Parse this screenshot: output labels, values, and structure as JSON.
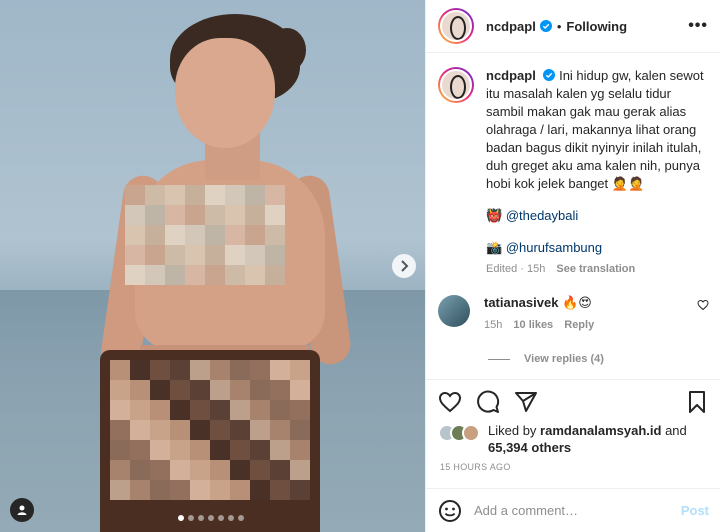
{
  "header": {
    "username": "ncdpapl",
    "separator": "•",
    "follow_status": "Following",
    "more_label": "•••"
  },
  "caption": {
    "username": "ncdpapl",
    "text": "Ini hidup gw, kalen sewot itu masalah kalen yg selalu tidur sambil makan gak mau gerak alias olahraga / lari, makannya lihat orang badan bagus dikit nyinyir inilah itulah, duh greget aku ama kalen nih, punya hobi kok jelek banget 🤦🤦",
    "mention1_emoji": "👹",
    "mention1": "@thedaybali",
    "mention2_emoji": "📸",
    "mention2": "@hurufsambung",
    "edited": "Edited · 15h",
    "see_translation": "See translation"
  },
  "comment": {
    "username": "tatianasivek",
    "text": "🔥😍",
    "time": "15h",
    "likes": "10 likes",
    "reply": "Reply",
    "view_replies": "View replies (4)"
  },
  "likes": {
    "prefix": "Liked by",
    "liker": "ramdanalamsyah.id",
    "and": "and",
    "others": "65,394 others"
  },
  "timestamp": "15 HOURS AGO",
  "comment_box": {
    "placeholder": "Add a comment…",
    "post_label": "Post"
  },
  "carousel": {
    "slide_count": 7,
    "active_index": 0
  },
  "colors": {
    "verified": "#0095f6",
    "link": "#00376b",
    "muted": "#8e8e8e",
    "post_disabled": "#b2dffc"
  },
  "icons": [
    "verified-icon",
    "more-icon",
    "heart-icon",
    "comment-icon",
    "share-icon",
    "bookmark-icon",
    "emoji-icon",
    "next-arrow-icon",
    "user-tag-icon"
  ]
}
